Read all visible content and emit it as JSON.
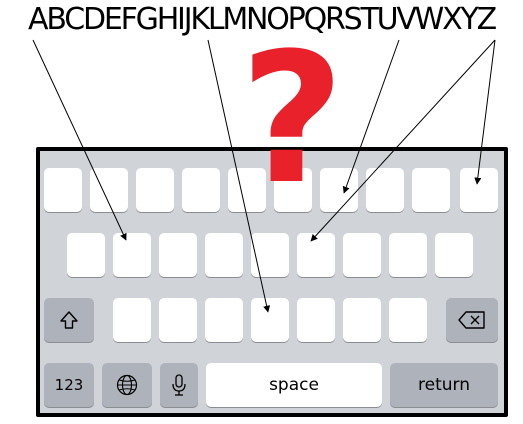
{
  "header": {
    "alphabet": "ABCDEFGHIJKLMNOPQRSTUVWXYZ"
  },
  "overlay": {
    "mark": "?",
    "mark_color": "#e8212b"
  },
  "keyboard": {
    "number_label": "123",
    "space_label": "space",
    "return_label": "return",
    "icons": [
      "shift-icon",
      "globe-icon",
      "microphone-icon",
      "backspace-icon"
    ]
  }
}
